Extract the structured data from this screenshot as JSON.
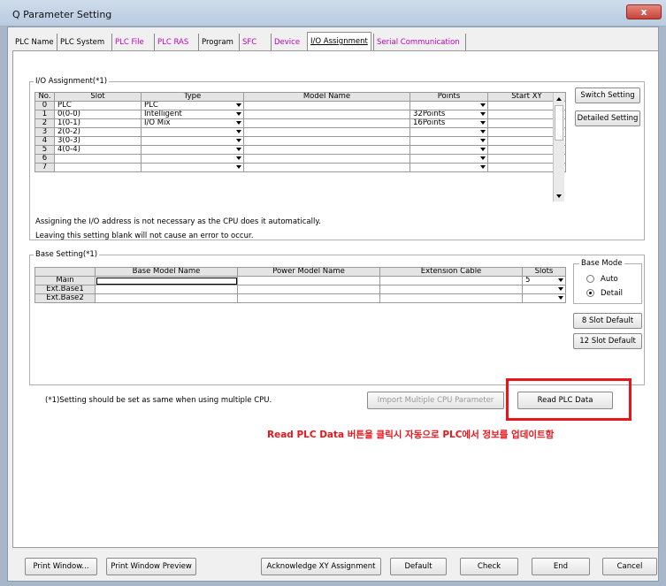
{
  "window": {
    "title": "Q Parameter Setting",
    "close_glyph": "x"
  },
  "tabs": [
    {
      "label": "PLC Name",
      "color": "#000000"
    },
    {
      "label": "PLC System",
      "color": "#000000"
    },
    {
      "label": "PLC File",
      "color": "#c000c0"
    },
    {
      "label": "PLC RAS",
      "color": "#c000c0"
    },
    {
      "label": "Program",
      "color": "#000000"
    },
    {
      "label": "SFC",
      "color": "#c000c0"
    },
    {
      "label": "Device",
      "color": "#c000c0"
    },
    {
      "label": "I/O Assignment",
      "color": "#000000"
    },
    {
      "label": "Serial Communication",
      "color": "#c000c0"
    }
  ],
  "io": {
    "group_label": "I/O Assignment(*1)",
    "headers": {
      "no": "No.",
      "slot": "Slot",
      "type": "Type",
      "model": "Model Name",
      "points": "Points",
      "startxy": "Start XY"
    },
    "rows": [
      {
        "no": "0",
        "slot": "PLC",
        "type": "PLC",
        "model": "",
        "points": "",
        "startxy": ""
      },
      {
        "no": "1",
        "slot": "0(0-0)",
        "type": "Intelligent",
        "model": "",
        "points": "32Points",
        "startxy": ""
      },
      {
        "no": "2",
        "slot": "1(0-1)",
        "type": "I/O Mix",
        "model": "",
        "points": "16Points",
        "startxy": ""
      },
      {
        "no": "3",
        "slot": "2(0-2)",
        "type": "",
        "model": "",
        "points": "",
        "startxy": ""
      },
      {
        "no": "4",
        "slot": "3(0-3)",
        "type": "",
        "model": "",
        "points": "",
        "startxy": ""
      },
      {
        "no": "5",
        "slot": "4(0-4)",
        "type": "",
        "model": "",
        "points": "",
        "startxy": ""
      },
      {
        "no": "6",
        "slot": "",
        "type": "",
        "model": "",
        "points": "",
        "startxy": ""
      },
      {
        "no": "7",
        "slot": "",
        "type": "",
        "model": "",
        "points": "",
        "startxy": ""
      }
    ],
    "buttons": {
      "switch": "Switch Setting",
      "detailed": "Detailed Setting"
    },
    "note1": "Assigning the I/O address is not necessary as the CPU does it automatically.",
    "note2": "Leaving this setting blank will not cause an error to occur."
  },
  "base": {
    "group_label": "Base Setting(*1)",
    "headers": {
      "model": "Base Model Name",
      "power": "Power Model Name",
      "cable": "Extension Cable",
      "slots": "Slots"
    },
    "rows": [
      {
        "label": "Main",
        "model": "",
        "power": "",
        "cable": "",
        "slots": "5"
      },
      {
        "label": "Ext.Base1",
        "model": "",
        "power": "",
        "cable": "",
        "slots": ""
      },
      {
        "label": "Ext.Base2",
        "model": "",
        "power": "",
        "cable": "",
        "slots": ""
      }
    ],
    "mode": {
      "label": "Base Mode",
      "auto": "Auto",
      "detail": "Detail",
      "selected": "Detail"
    },
    "buttons": {
      "slot8": "8 Slot Default",
      "slot12": "12 Slot Default"
    }
  },
  "footnote": "(*1)Setting should be set as same when using multiple CPU.",
  "buttons": {
    "import_multi": "Import Multiple CPU Parameter",
    "read_plc": "Read PLC Data",
    "print_window": "Print Window...",
    "print_preview": "Print Window Preview",
    "ack_xy": "Acknowledge XY Assignment",
    "default": "Default",
    "check": "Check",
    "end": "End",
    "cancel": "Cancel"
  },
  "annotation": {
    "text": "Read PLC Data 버튼을 클릭시 자동으로 PLC에서 정보를 업데이트함",
    "color": "#e8151b"
  }
}
